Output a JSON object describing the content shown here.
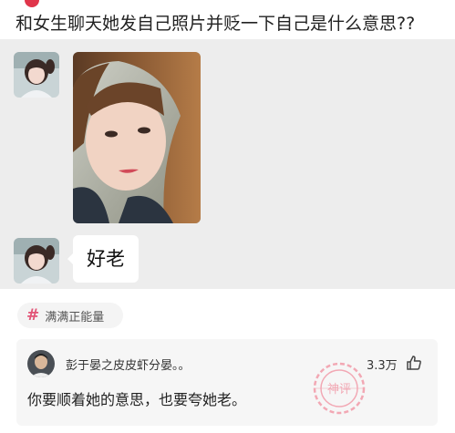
{
  "question": {
    "title": "和女生聊天她发自己照片并贬一下自己是什么意思??"
  },
  "chat": {
    "message_text": "好老"
  },
  "tag": {
    "icon": "hash-icon",
    "icon_glyph": "#",
    "label": "满满正能量"
  },
  "comment": {
    "username": "彭于晏之皮皮虾分晏。。",
    "like_count": "3.3万",
    "text": "你要顺着她的意思，也要夸她老。",
    "stamp_text": "神评"
  },
  "colors": {
    "accent": "#e25577",
    "chat_background": "#ededed",
    "stamp": "#f2a8b4"
  }
}
